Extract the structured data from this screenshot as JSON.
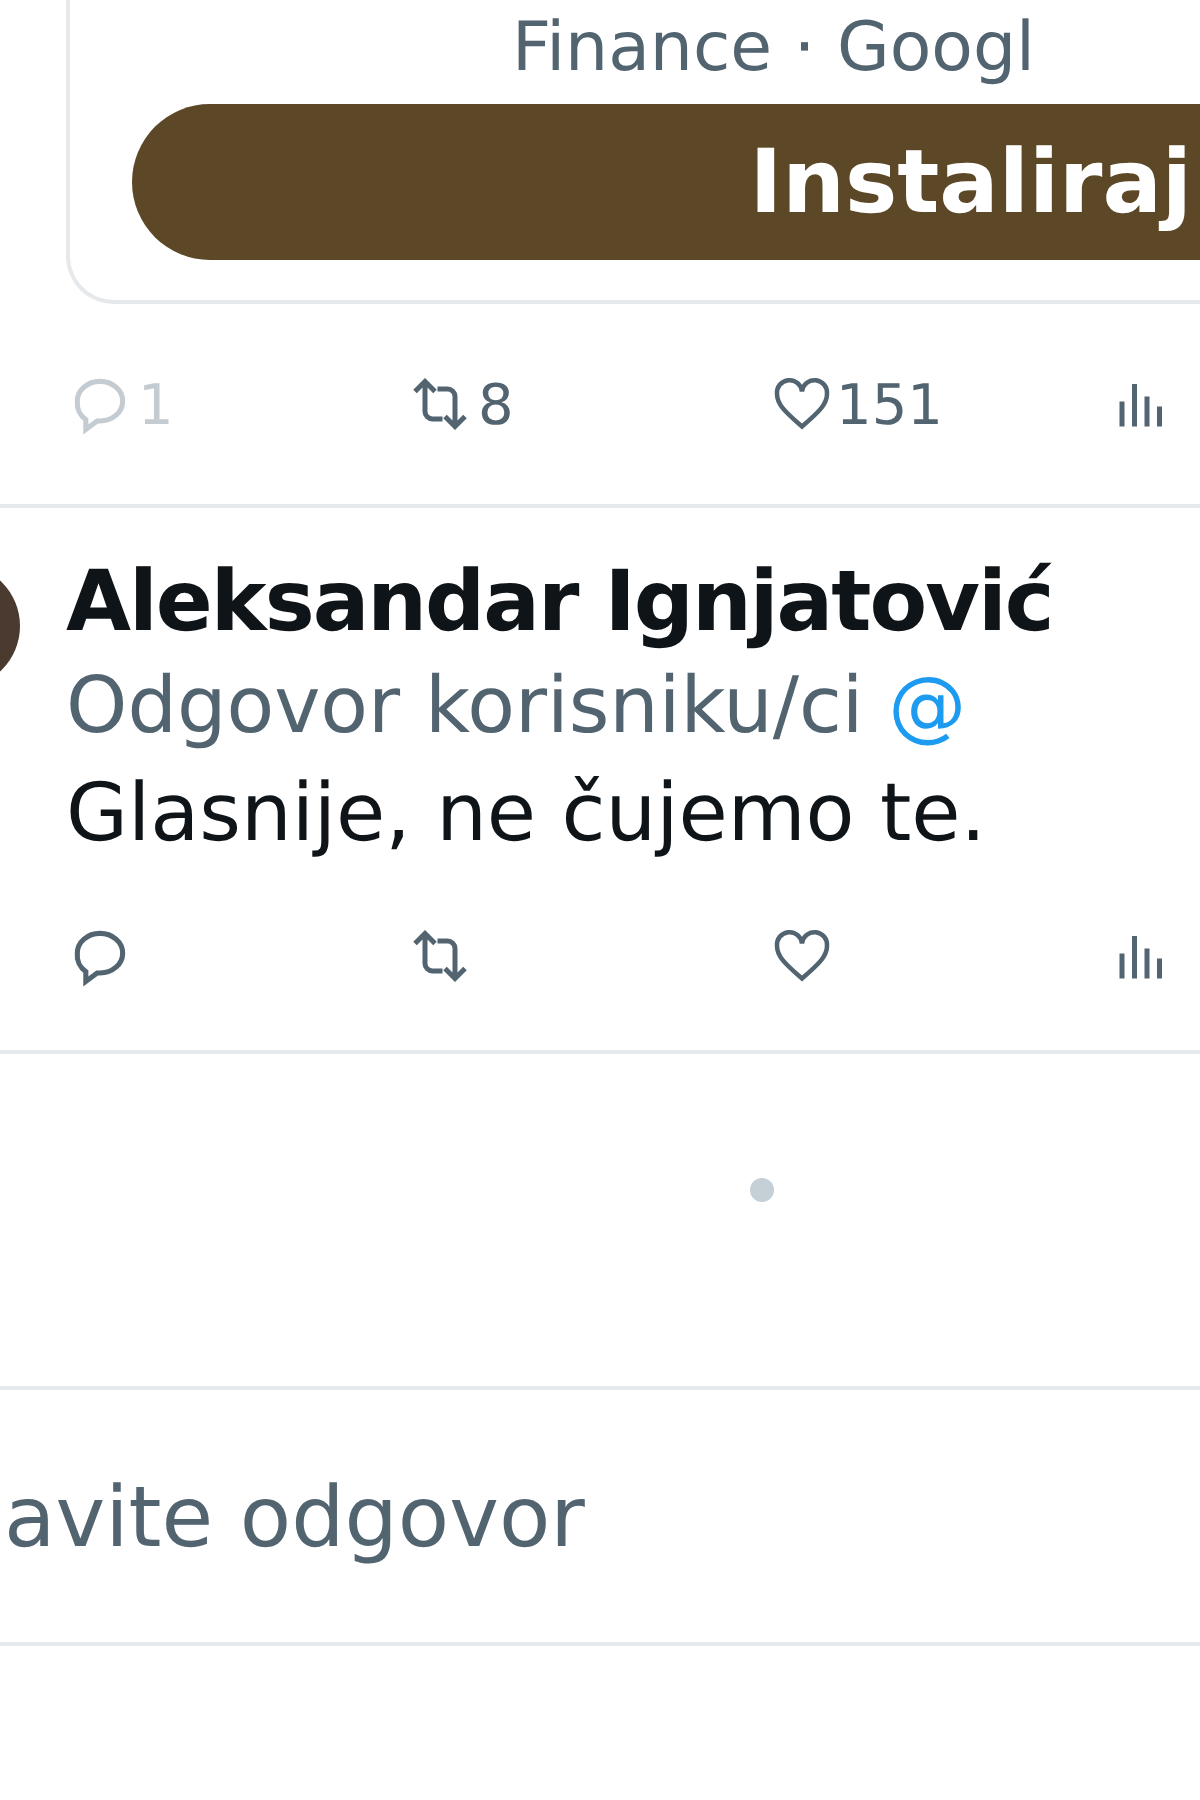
{
  "app_card": {
    "source": "Finance · Googl",
    "button": "Instaliraj"
  },
  "tweet_actions": [
    {
      "kind": "reply",
      "count": "1"
    },
    {
      "kind": "retweet",
      "count": "8"
    },
    {
      "kind": "like",
      "count": "151"
    },
    {
      "kind": "views"
    }
  ],
  "reply": {
    "author": "Aleksandar Ignjatović",
    "replying_to": "Odgovor korisniku/ci",
    "mention": "@",
    "text": "Glasnije, ne čujemo te.",
    "actions": [
      {
        "kind": "reply"
      },
      {
        "kind": "retweet"
      },
      {
        "kind": "like"
      },
      {
        "kind": "views"
      }
    ]
  },
  "composer": {
    "placeholder": "avite odgovor"
  }
}
